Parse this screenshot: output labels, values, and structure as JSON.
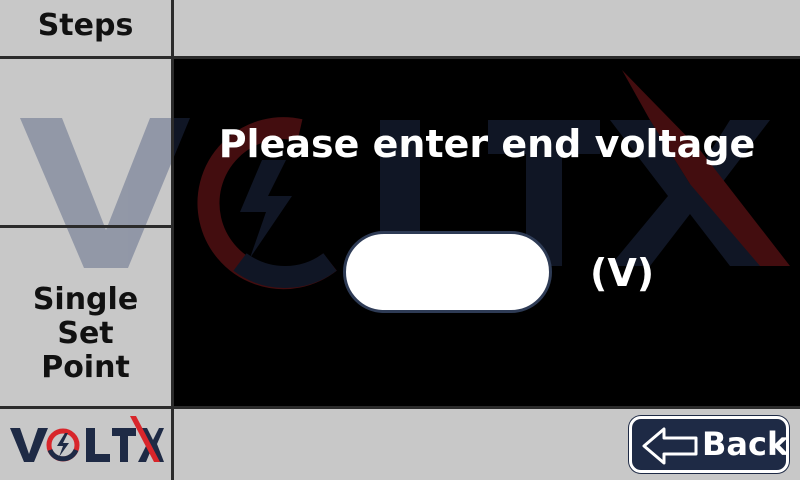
{
  "sidebar": {
    "steps_label": "Steps",
    "mode_label_line1": "Single Set",
    "mode_label_line2": "Point",
    "logo_text": "VOLTX"
  },
  "prompt": {
    "title": "Please enter end voltage",
    "input_value": "",
    "unit": "(V)"
  },
  "back_button": {
    "label": "Back",
    "icon": "arrow-left-outline-icon"
  },
  "colors": {
    "panel_gray": "#c8c8c8",
    "main_bg": "#000000",
    "brand_navy": "#1e2a45",
    "brand_red": "#d8262b"
  }
}
